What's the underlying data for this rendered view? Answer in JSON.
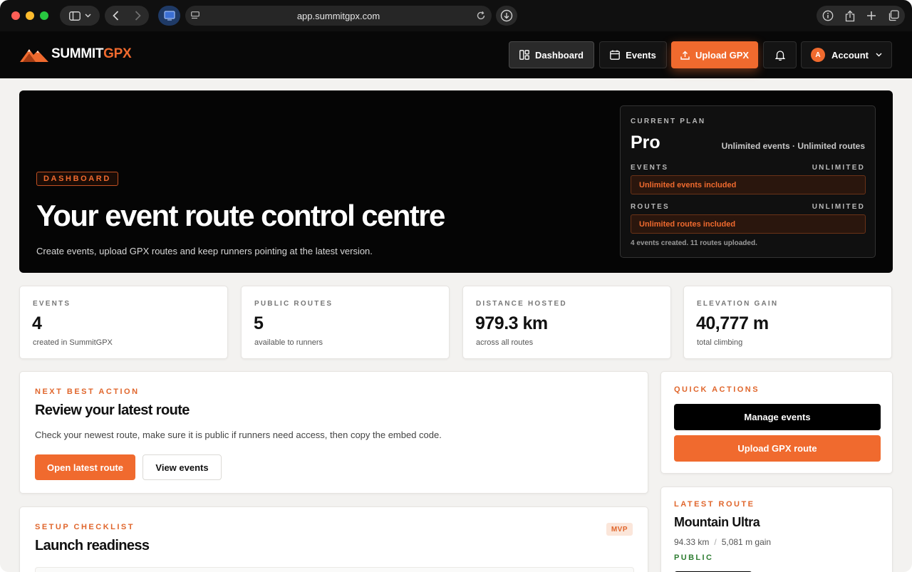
{
  "browser": {
    "url": "app.summitgpx.com"
  },
  "brand": {
    "name_part1": "SUMMIT",
    "name_part2": "GPX",
    "accent": "#f06a2e"
  },
  "nav": {
    "dashboard": "Dashboard",
    "events": "Events",
    "upload": "Upload GPX",
    "account": "Account",
    "avatar_initial": "A"
  },
  "hero": {
    "chip": "DASHBOARD",
    "title": "Your event route control centre",
    "subtitle": "Create events, upload GPX routes and keep runners pointing at the latest version."
  },
  "plan": {
    "label": "CURRENT PLAN",
    "name": "Pro",
    "summary": "Unlimited events · Unlimited routes",
    "events_label": "EVENTS",
    "events_limit": "UNLIMITED",
    "events_bar": "Unlimited events included",
    "routes_label": "ROUTES",
    "routes_limit": "UNLIMITED",
    "routes_bar": "Unlimited routes included",
    "footnote": "4 events created. 11 routes uploaded."
  },
  "stats": [
    {
      "label": "EVENTS",
      "value": "4",
      "sub": "created in SummitGPX"
    },
    {
      "label": "PUBLIC ROUTES",
      "value": "5",
      "sub": "available to runners"
    },
    {
      "label": "DISTANCE HOSTED",
      "value": "979.3 km",
      "sub": "across all routes"
    },
    {
      "label": "ELEVATION GAIN",
      "value": "40,777 m",
      "sub": "total climbing"
    }
  ],
  "next_action": {
    "label": "NEXT BEST ACTION",
    "title": "Review your latest route",
    "text": "Check your newest route, make sure it is public if runners need access, then copy the embed code.",
    "primary": "Open latest route",
    "secondary": "View events"
  },
  "quick_actions": {
    "label": "QUICK ACTIONS",
    "manage": "Manage events",
    "upload": "Upload GPX route"
  },
  "checklist": {
    "label": "SETUP CHECKLIST",
    "title": "Launch readiness",
    "badge": "MVP"
  },
  "latest_route": {
    "label": "LATEST ROUTE",
    "name": "Mountain Ultra",
    "distance": "94.33 km",
    "separator": "/",
    "gain": "5,081 m gain",
    "status": "PUBLIC"
  }
}
